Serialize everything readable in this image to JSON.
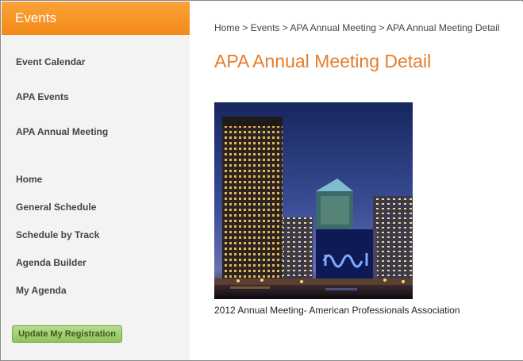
{
  "sidebar": {
    "title": "Events",
    "items": [
      {
        "label": "Event Calendar"
      },
      {
        "label": "APA Events"
      },
      {
        "label": "APA Annual Meeting"
      },
      {
        "label": "Home"
      },
      {
        "label": "General Schedule"
      },
      {
        "label": "Schedule by Track"
      },
      {
        "label": "Agenda Builder"
      },
      {
        "label": "My Agenda"
      }
    ],
    "update_button": "Update My Registration"
  },
  "breadcrumb": {
    "items": [
      "Home",
      "Events",
      "APA Annual Meeting",
      "APA Annual Meeting Detail"
    ],
    "separator": ">"
  },
  "main": {
    "title": "APA Annual Meeting Detail",
    "caption": "2012 Annual Meeting- American Professionals Association"
  },
  "colors": {
    "accent": "#e47d2c",
    "header": "#f7941d",
    "button": "#9ccb6a"
  }
}
